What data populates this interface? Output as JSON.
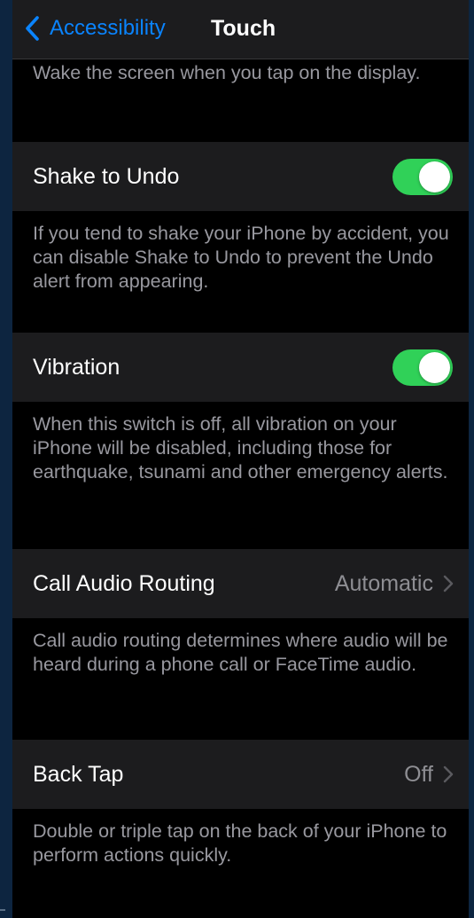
{
  "navbar": {
    "back_label": "Accessibility",
    "title": "Touch"
  },
  "tap_to_wake": {
    "footer": "Wake the screen when you tap on the display."
  },
  "shake_to_undo": {
    "label": "Shake to Undo",
    "enabled": true,
    "footer": "If you tend to shake your iPhone by accident, you can disable Shake to Undo to prevent the Undo alert from appearing."
  },
  "vibration": {
    "label": "Vibration",
    "enabled": true,
    "footer": "When this switch is off, all vibration on your iPhone will be disabled, including those for earthquake, tsunami and other emergency alerts."
  },
  "call_audio_routing": {
    "label": "Call Audio Routing",
    "value": "Automatic",
    "footer": "Call audio routing determines where audio will be heard during a phone call or FaceTime audio."
  },
  "back_tap": {
    "label": "Back Tap",
    "value": "Off",
    "footer": "Double or triple tap on the back of your iPhone to perform actions quickly."
  },
  "colors": {
    "accent": "#0a84ff",
    "toggle_on": "#30d158",
    "cell_background": "#1c1c1e",
    "secondary_text": "#98989f"
  },
  "icons": {
    "back": "chevron-left-icon",
    "disclosure": "chevron-right-icon"
  }
}
